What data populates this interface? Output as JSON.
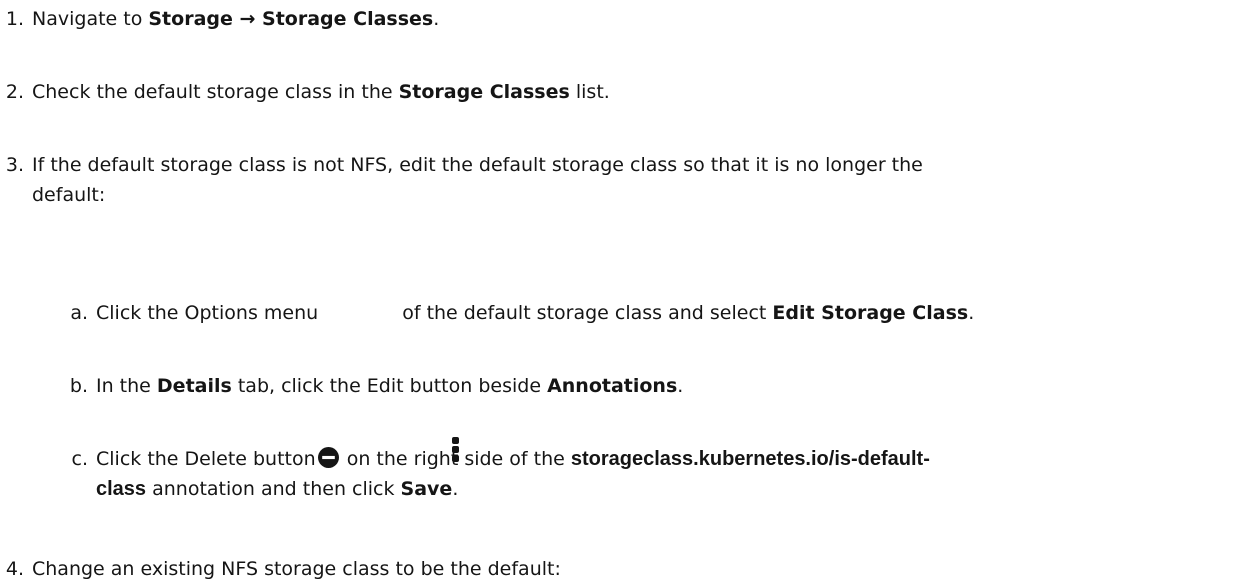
{
  "steps": [
    {
      "num": "1.",
      "pre": "Navigate to ",
      "bold": "Storage → Storage Classes",
      "post": "."
    },
    {
      "num": "2.",
      "pre": "Check the default storage class in the ",
      "bold": "Storage Classes",
      "post": " list."
    },
    {
      "num": "3.",
      "line1": "If the default storage class is not NFS, edit the default storage class so that it is no longer the",
      "line2": "default:"
    },
    {
      "num": "4.",
      "text": "Change an existing NFS storage class to be the default:"
    }
  ],
  "substeps": [
    {
      "num": "a.",
      "pre": "Click the Options menu",
      "mid": " of the default storage class and select ",
      "bold": "Edit Storage Class",
      "post": "."
    },
    {
      "num": "b.",
      "pre": "In the ",
      "bold1": "Details",
      "mid": " tab, click the Edit button beside ",
      "bold2": "Annotations",
      "post": "."
    },
    {
      "num": "c.",
      "pre": "Click the Delete button",
      "mid": " on the right side of the ",
      "bold1": "storageclass.kubernetes.io/is-default-",
      "bold1b": "class",
      "mid2": " annotation and then click ",
      "bold2": "Save",
      "post": "."
    }
  ],
  "icons": {
    "options": "kebab-menu-icon",
    "delete": "minus-circle-icon"
  }
}
